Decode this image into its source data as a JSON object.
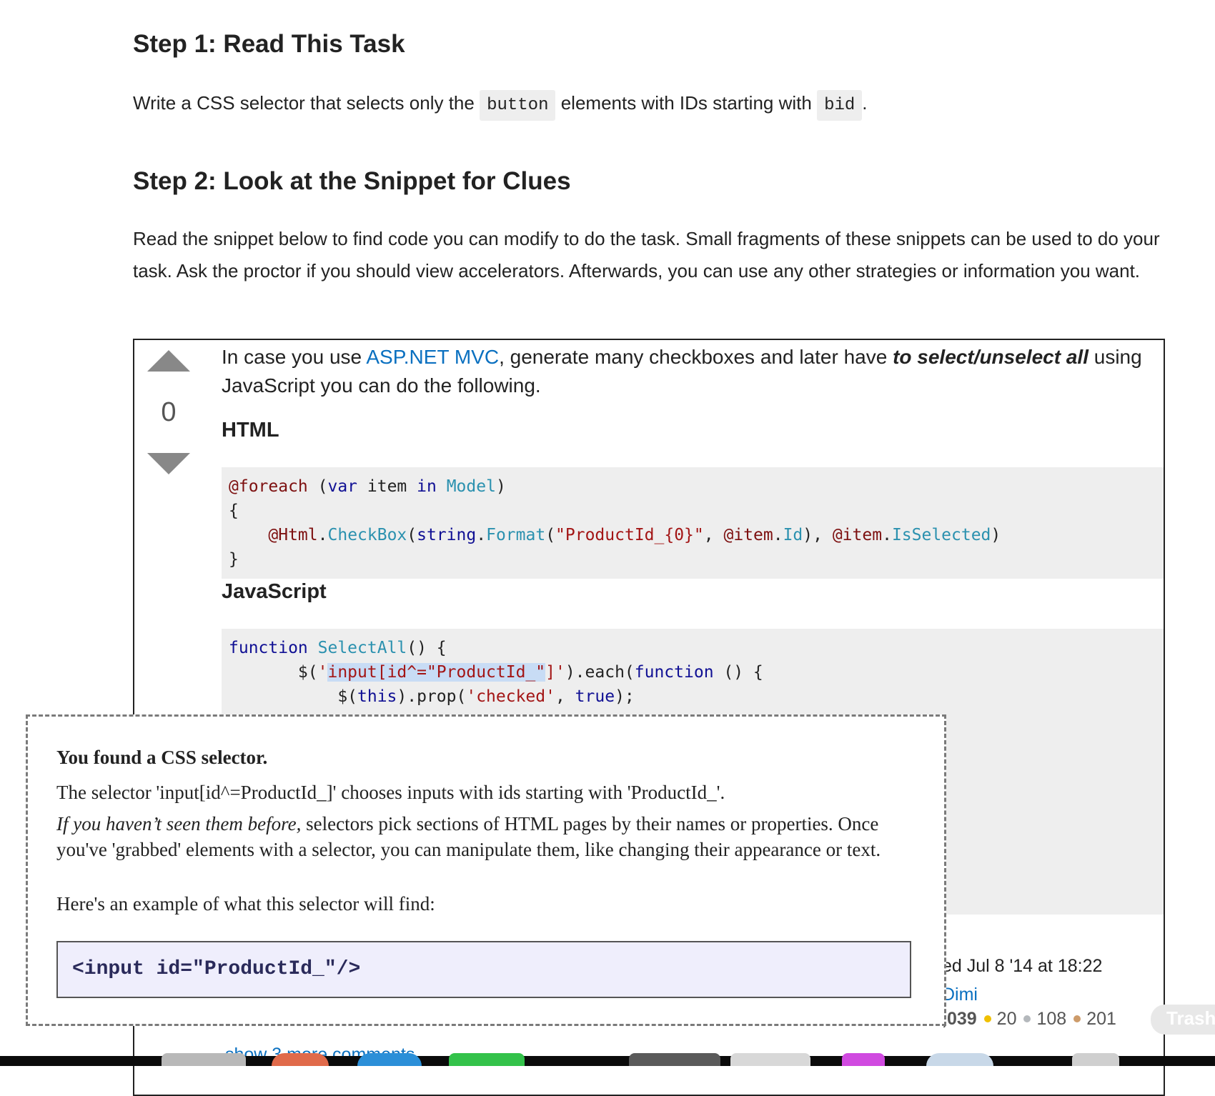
{
  "step1": {
    "heading": "Step 1: Read This Task",
    "text_before": "Write a CSS selector that selects only the ",
    "code1": "button",
    "text_mid": " elements with IDs starting with ",
    "code2": "bid",
    "text_after": "."
  },
  "step2": {
    "heading": "Step 2: Look at the Snippet for Clues",
    "paragraph": "Read the snippet below to find code you can modify to do the task. Small fragments of these snippets can be used to do your task. Ask the proctor if you should view accelerators. Afterwards, you can use any other strategies or information you want."
  },
  "answer": {
    "vote_count": "0",
    "intro_1": "In case you use ",
    "intro_link": "ASP.NET MVC",
    "intro_2": ", generate many checkboxes and later have ",
    "intro_bold": "to select/unselect all",
    "intro_3": " using JavaScript you can do the following.",
    "html_heading": "HTML",
    "js_heading": "JavaScript",
    "meta_date": "ed Jul 8 '14 at 18:22",
    "meta_user": "Dimi",
    "meta_rep": ",039",
    "badge_gold": "20",
    "badge_silver": "108",
    "badge_bronze": "201",
    "show_more": "show 3 more comments"
  },
  "popup": {
    "title": "You found a CSS selector.",
    "line1": "The selector 'input[id^=ProductId_]' chooses inputs with ids starting with 'ProductId_'.",
    "line2_em": "If you haven’t seen them before,",
    "line2_rest": " selectors pick sections of HTML pages by their names or properties. Once you've 'grabbed' elements with a selector, you can manipulate them, like changing their appearance or text.",
    "line3": "Here's an example of what this selector will find:",
    "example": "<input id=\"ProductId_\"/>"
  },
  "dock": {
    "trash_label": "Trash"
  },
  "colors": {
    "link": "#0a70c0",
    "keyword": "#101094",
    "razor": "#7d1010",
    "type": "#2b91af",
    "string": "#a31515",
    "badge_gold": "#f0c000",
    "badge_silver": "#b4b8bc",
    "badge_bronze": "#cd9b6a"
  }
}
